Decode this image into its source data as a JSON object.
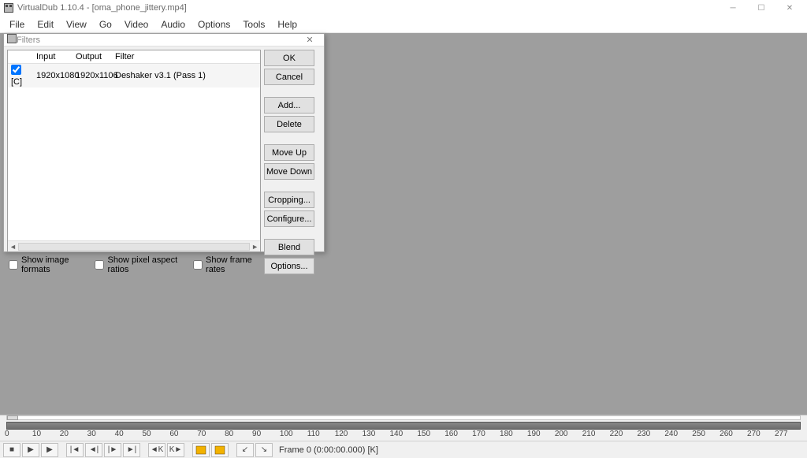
{
  "window": {
    "title": "VirtualDub 1.10.4 - [oma_phone_jittery.mp4]"
  },
  "menu": [
    "File",
    "Edit",
    "View",
    "Go",
    "Video",
    "Audio",
    "Options",
    "Tools",
    "Help"
  ],
  "dialog": {
    "title": "Filters",
    "columns": {
      "input": "Input",
      "output": "Output",
      "filter": "Filter"
    },
    "rows": [
      {
        "checked": true,
        "tag": "[C]",
        "input": "1920x1080",
        "output": "1920x1106",
        "filter": "Deshaker v3.1 (Pass 1)"
      }
    ],
    "checks": {
      "image_formats": "Show image formats",
      "pixel_aspect": "Show pixel aspect ratios",
      "frame_rates": "Show frame rates"
    },
    "buttons": {
      "ok": "OK",
      "cancel": "Cancel",
      "add": "Add...",
      "delete": "Delete",
      "moveup": "Move Up",
      "movedown": "Move Down",
      "cropping": "Cropping...",
      "configure": "Configure...",
      "blend": "Blend",
      "options": "Options..."
    }
  },
  "timeline": {
    "ticks": [
      "0",
      "10",
      "20",
      "30",
      "40",
      "50",
      "60",
      "70",
      "80",
      "90",
      "100",
      "110",
      "120",
      "130",
      "140",
      "150",
      "160",
      "170",
      "180",
      "190",
      "200",
      "210",
      "220",
      "230",
      "240",
      "250",
      "260",
      "270",
      "277"
    ]
  },
  "status": "Frame 0 (0:00:00.000) [K]"
}
